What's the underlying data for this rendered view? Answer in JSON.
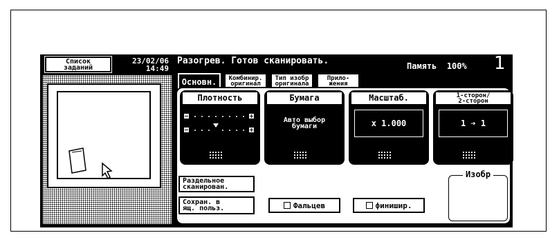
{
  "job_list": {
    "line1": "Список",
    "line2": "заданий"
  },
  "datetime": {
    "date": "23/02/06",
    "time": "14:49"
  },
  "status": {
    "message": "Разогрев. Готов сканировать.",
    "memory_label": "Память",
    "memory_value": "100%",
    "copies": "1"
  },
  "tabs": [
    {
      "label": "Основн."
    },
    {
      "line1": "Комбинир.",
      "line2": "оригинал"
    },
    {
      "line1": "Тип изобр",
      "line2": "оригинала"
    },
    {
      "line1": "Прило-",
      "line2": "жения"
    }
  ],
  "cards": [
    {
      "title": "Плотность"
    },
    {
      "title": "Бумага",
      "value1": "Авто выбор",
      "value2": "бумаги"
    },
    {
      "title": "Масштаб.",
      "value": "x 1.000"
    },
    {
      "title1": "1-сторон/",
      "title2": "2-сторон",
      "value": "1 ➔ 1"
    }
  ],
  "buttons": {
    "separate_scan1": "Раздельное",
    "separate_scan2": "сканирован.",
    "save_box1": "Сохран. в",
    "save_box2": "ящ. польз.",
    "fold": "Фальцев",
    "finish": "финишир."
  },
  "image_box": {
    "label": "Изобр"
  }
}
